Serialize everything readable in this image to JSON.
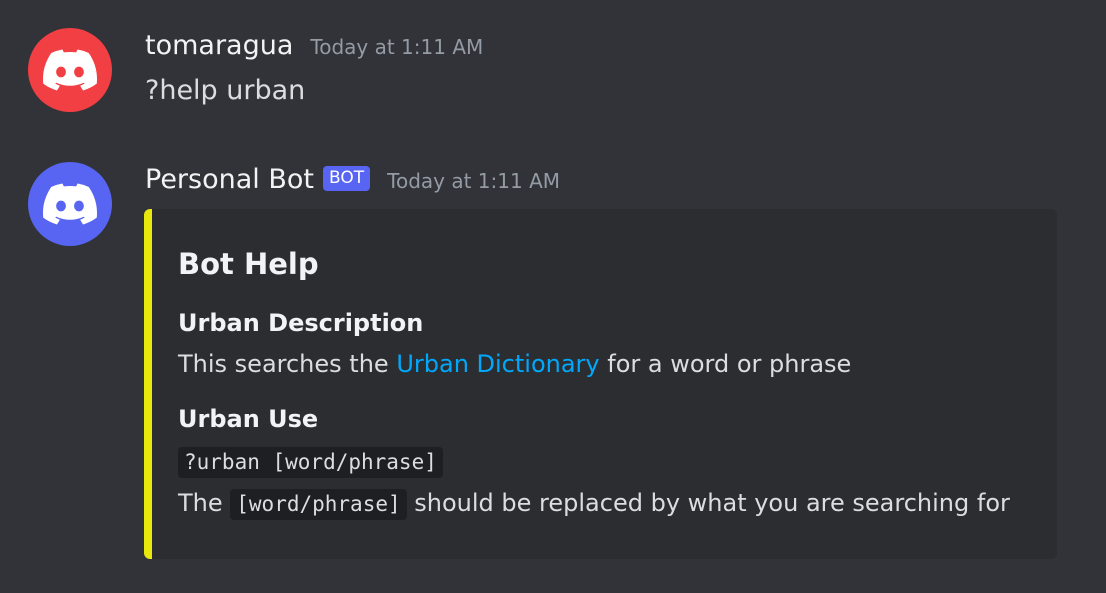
{
  "messages": [
    {
      "avatar_color": "#f23f43",
      "avatar_icon": "discord-logo-icon",
      "username": "tomaragua",
      "timestamp": "Today at 1:11 AM",
      "content": "?help urban"
    },
    {
      "avatar_color": "#5865f2",
      "avatar_icon": "discord-logo-icon",
      "username": "Personal Bot",
      "badge": "BOT",
      "timestamp": "Today at 1:11 AM",
      "embed": {
        "accent_color": "#e8e80c",
        "title": "Bot Help",
        "fields": [
          {
            "name": "Urban Description",
            "value_before": "This searches the ",
            "link_text": "Urban Dictionary",
            "value_after": " for a word or phrase"
          },
          {
            "name": "Urban Use",
            "code": "?urban [word/phrase]",
            "value_prefix": "The ",
            "inline_code": "[word/phrase]",
            "value_suffix": " should be replaced by what you are searching for"
          }
        ]
      }
    }
  ]
}
